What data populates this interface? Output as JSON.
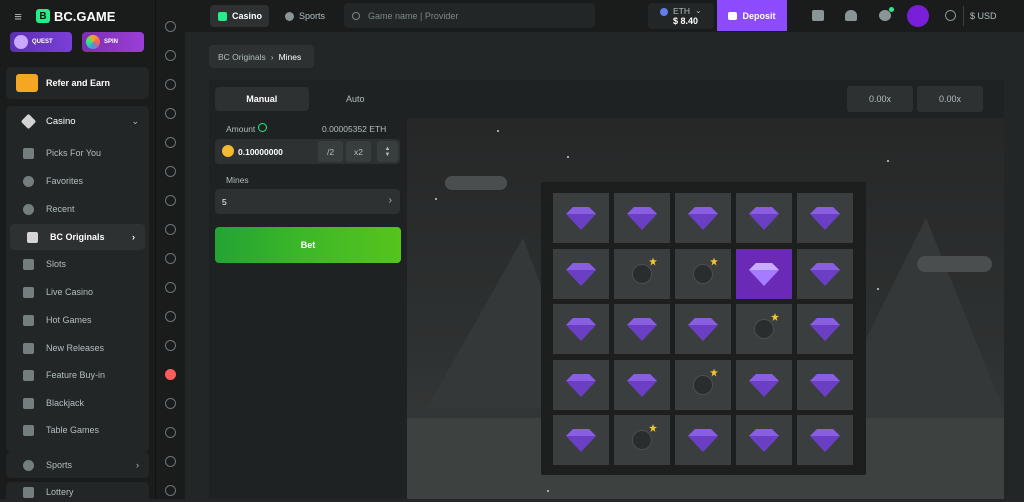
{
  "app": {
    "logo_text": "BC.GAME"
  },
  "promos": [
    {
      "label": "QUEST"
    },
    {
      "label": "SPIN"
    }
  ],
  "sidebar": {
    "refer": "Refer and Earn",
    "casino": "Casino",
    "items": [
      {
        "label": "Picks For You"
      },
      {
        "label": "Favorites"
      },
      {
        "label": "Recent"
      },
      {
        "label": "BC Originals"
      },
      {
        "label": "Slots"
      },
      {
        "label": "Live Casino"
      },
      {
        "label": "Hot Games"
      },
      {
        "label": "New Releases"
      },
      {
        "label": "Feature Buy-in"
      },
      {
        "label": "Blackjack"
      },
      {
        "label": "Table Games"
      }
    ],
    "sports": "Sports",
    "lottery": "Lottery"
  },
  "header": {
    "tab_casino": "Casino",
    "tab_sports": "Sports",
    "search_placeholder": "Game name | Provider",
    "currency": "ETH",
    "balance": "$ 8.40",
    "deposit": "Deposit",
    "fiat": "$ USD"
  },
  "breadcrumb": {
    "parent": "BC Originals",
    "current": "Mines"
  },
  "controls": {
    "mode_manual": "Manual",
    "mode_auto": "Auto",
    "amount_label": "Amount",
    "amount_eth": "0.00005352 ETH",
    "amount_value": "0.10000000",
    "half": "/2",
    "double": "x2",
    "mines_label": "Mines",
    "mines_value": "5",
    "bet": "Bet"
  },
  "multipliers": [
    "0.00x",
    "0.00x"
  ],
  "board": {
    "rows": 5,
    "cols": 5,
    "cells": [
      "gem",
      "gem",
      "gem",
      "gem",
      "gem",
      "gem",
      "bomb",
      "bomb",
      "gem-selected",
      "gem",
      "gem",
      "gem",
      "gem",
      "bomb",
      "gem",
      "gem",
      "gem",
      "bomb",
      "gem",
      "gem",
      "gem",
      "bomb",
      "gem",
      "gem",
      "gem"
    ]
  },
  "colors": {
    "accent": "#8c4bff",
    "bet": "#3fb827",
    "brand": "#24ee89"
  }
}
